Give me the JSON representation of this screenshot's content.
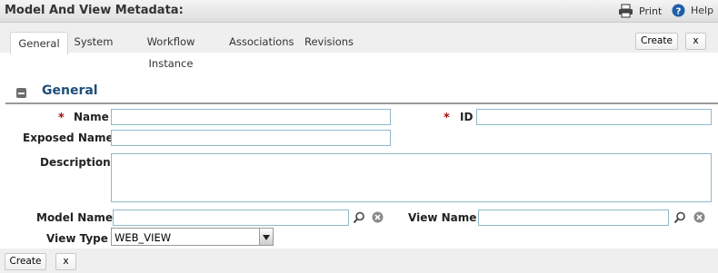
{
  "window": {
    "title": "Model And View Metadata:"
  },
  "toolbar": {
    "print_label": "Print",
    "help_label": "Help"
  },
  "tabs": [
    {
      "label": "General",
      "active": true
    },
    {
      "label": "System",
      "active": false
    },
    {
      "label": "Workflow Instance",
      "active": false
    },
    {
      "label": "Associations",
      "active": false
    },
    {
      "label": "Revisions",
      "active": false
    }
  ],
  "actions": {
    "create_label": "Create",
    "close_label": "x"
  },
  "section": {
    "title": "General"
  },
  "form": {
    "required_mark": "*",
    "name_label": "Name",
    "name_value": "",
    "id_label": "ID",
    "id_value": "",
    "exposed_name_label": "Exposed Name",
    "exposed_name_value": "",
    "description_label": "Description",
    "description_value": "",
    "model_name_label": "Model Name",
    "model_name_value": "",
    "view_name_label": "View Name",
    "view_name_value": "",
    "view_type_label": "View Type",
    "view_type_value": "WEB_VIEW"
  },
  "footer": {
    "create_label": "Create",
    "close_label": "x"
  },
  "colors": {
    "section_title": "#1f4e79",
    "required": "#a01010",
    "field_border": "#8fb8cc"
  }
}
